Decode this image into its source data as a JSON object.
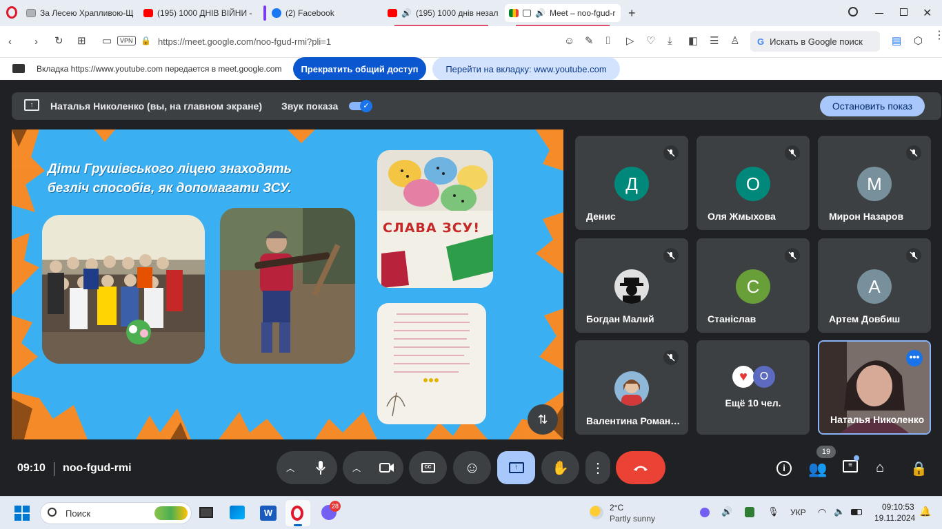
{
  "tabs": [
    {
      "label": "За Лесею Храпливою-Щ",
      "icon": "document-icon",
      "color": "#888888"
    },
    {
      "label": "(195) 1000 ДНІВ ВІЙНИ -",
      "icon": "youtube-icon",
      "color": "#ff0000"
    },
    {
      "label": "(2) Facebook",
      "icon": "facebook-icon",
      "color": "#1877f2"
    },
    {
      "label": "(195) 1000 днів незал",
      "icon": "youtube-icon",
      "color": "#ff0000"
    },
    {
      "label": "Meet – noo-fgud-r",
      "icon": "meet-icon",
      "color": "#00832d"
    }
  ],
  "address": {
    "url": "https://meet.google.com/noo-fgud-rmi?pli=1",
    "vpn": "VPN",
    "search_label": "Искать в Google поиск"
  },
  "sharebar": {
    "text": "Вкладка https://www.youtube.com передается в meet.google.com",
    "stop_label": "Прекратить общий доступ",
    "goto_label": "Перейти на вкладку: www.youtube.com"
  },
  "banner": {
    "presenter": "Наталья Николенко (вы, на главном экране)",
    "sound_label": "Звук показа",
    "stop_label": "Остановить показ"
  },
  "slide": {
    "title_line1": "Діти Грушівського ліцею знаходять",
    "title_line2": "безліч способів, як допомагати ЗСУ.",
    "poster_text": "СЛАВА ЗСУ!"
  },
  "participants": [
    {
      "name": "Денис",
      "initial": "Д",
      "color": "#00897b",
      "muted": true
    },
    {
      "name": "Оля Жмыхова",
      "initial": "О",
      "color": "#00897b",
      "muted": true
    },
    {
      "name": "Мирон Назаров",
      "initial": "М",
      "color": "#78909c",
      "muted": true
    },
    {
      "name": "Богдан Малий",
      "initial": "",
      "color": "#e0e0e0",
      "muted": true
    },
    {
      "name": "Станіслав",
      "initial": "С",
      "color": "#689f38",
      "muted": true
    },
    {
      "name": "Артем Довбиш",
      "initial": "А",
      "color": "#78909c",
      "muted": true
    },
    {
      "name": "Валентина Романенко",
      "initial": "",
      "color": "#8fb8d8",
      "muted": true
    }
  ],
  "more": {
    "label": "Ещё 10 чел.",
    "initial": "О",
    "color": "#5c6bc0"
  },
  "self": {
    "name": "Наталья Николенко"
  },
  "meeting": {
    "time": "09:10",
    "code": "noo-fgud-rmi",
    "participants_count": "19"
  },
  "colors": {
    "end_call": "#ea4335",
    "present_active": "#a8c7fa",
    "accent": "#8ab4f8"
  },
  "taskbar": {
    "search_placeholder": "Поиск",
    "weather_temp": "2°C",
    "weather_desc": "Partly sunny",
    "lang": "УКР",
    "clock_time": "09:10:53",
    "clock_date": "19.11.2024",
    "viber_badge": "28"
  }
}
